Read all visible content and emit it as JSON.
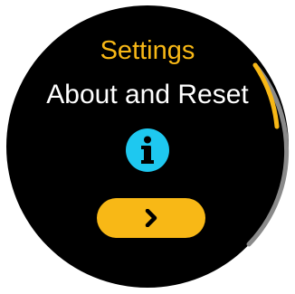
{
  "screen": {
    "title": "Settings",
    "subtitle": "About and Reset"
  },
  "icons": {
    "info": "info-icon",
    "next": "chevron-right-icon"
  },
  "scroll": {
    "position_fraction": 0.0,
    "visible_fraction": 0.25
  },
  "colors": {
    "accent": "#f8b816",
    "info": "#1ec8f0",
    "background": "#000000",
    "text": "#ffffff",
    "scroll_track": "#8a8a8a"
  }
}
